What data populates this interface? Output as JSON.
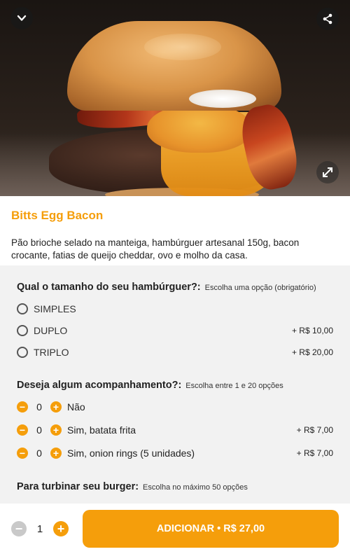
{
  "hero": {
    "back_icon": "chevron-down-icon",
    "share_icon": "share-icon",
    "expand_icon": "expand-icon"
  },
  "product": {
    "title": "Bitts Egg Bacon",
    "description": "Pão brioche selado na manteiga, hambúrguer artesanal 150g, bacon crocante, fatias de queijo cheddar, ovo e molho da casa."
  },
  "size_group": {
    "title": "Qual o tamanho do seu hambúrguer?:",
    "hint": "Escolha uma opção (obrigatório)",
    "options": [
      {
        "label": "SIMPLES",
        "price": ""
      },
      {
        "label": "DUPLO",
        "price": "+ R$ 10,00"
      },
      {
        "label": "TRIPLO",
        "price": "+ R$ 20,00"
      }
    ]
  },
  "side_group": {
    "title": "Deseja algum acompanhamento?:",
    "hint": "Escolha entre 1 e 20 opções",
    "options": [
      {
        "qty": "0",
        "label": "Não",
        "price": ""
      },
      {
        "qty": "0",
        "label": "Sim, batata frita",
        "price": "+ R$ 7,00"
      },
      {
        "qty": "0",
        "label": "Sim, onion rings (5 unidades)",
        "price": "+ R$ 7,00"
      }
    ]
  },
  "boost_group": {
    "title": "Para turbinar seu burger:",
    "hint": "Escolha no máximo 50 opções"
  },
  "footer": {
    "quantity": "1",
    "minus_symbol": "−",
    "plus_symbol": "+",
    "add_label": "ADICIONAR • R$ 27,00"
  },
  "colors": {
    "accent": "#f59e0b",
    "background": "#f2f2f2"
  }
}
